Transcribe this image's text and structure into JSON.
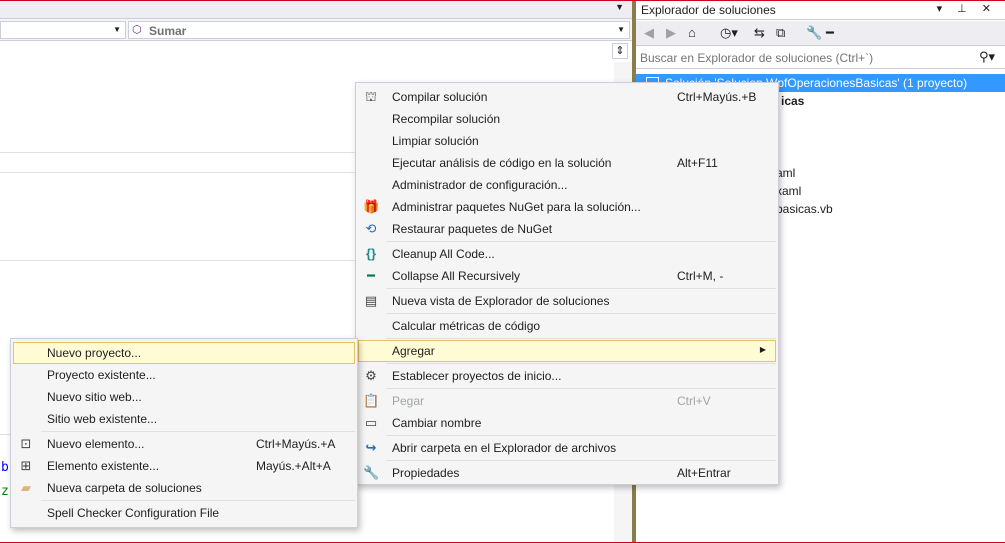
{
  "editor": {
    "nav_right_label": "Sumar",
    "code_glyphs": [
      {
        "text": "b",
        "color": "#0000ff"
      },
      {
        "text": "z",
        "color": "#008000"
      }
    ]
  },
  "solution_explorer": {
    "title": "Explorador de soluciones",
    "title_buttons": "▾ ⊥ ✕",
    "search_placeholder": "Buscar en Explorador de soluciones (Ctrl+`)",
    "tree": [
      {
        "label": "Solución 'Solucion WpfOperacionesBasicas'  (1 proyecto)",
        "selected": true
      },
      {
        "label": "icas",
        "bold": true
      },
      {
        "label": "aml"
      },
      {
        "label": "xaml"
      },
      {
        "label": "basicas.vb"
      }
    ]
  },
  "context_menu": {
    "items": [
      {
        "icon": "build-icon",
        "glyph": "⛫",
        "label": "Compilar solución",
        "shortcut": "Ctrl+Mayús.+B"
      },
      {
        "icon": "",
        "glyph": "",
        "label": "Recompilar solución",
        "shortcut": ""
      },
      {
        "icon": "",
        "glyph": "",
        "label": "Limpiar solución",
        "shortcut": ""
      },
      {
        "icon": "",
        "glyph": "",
        "label": "Ejecutar análisis de código en la solución",
        "shortcut": "Alt+F11"
      },
      {
        "icon": "",
        "glyph": "",
        "label": "Administrador de configuración...",
        "shortcut": ""
      },
      {
        "icon": "nuget-package-icon",
        "glyph": "🎁",
        "label": "Administrar paquetes NuGet para la solución...",
        "shortcut": ""
      },
      {
        "icon": "restore-package-icon",
        "glyph": "⟲",
        "label": "Restaurar paquetes de NuGet",
        "shortcut": ""
      },
      {
        "icon": "cleanup-code-icon",
        "glyph": "{}",
        "label": "Cleanup All Code...",
        "shortcut": ""
      },
      {
        "icon": "collapse-icon",
        "glyph": "━",
        "label": "Collapse All Recursively",
        "shortcut": "Ctrl+M, -"
      },
      {
        "icon": "new-explorer-view-icon",
        "glyph": "▤",
        "label": "Nueva vista de Explorador de soluciones",
        "shortcut": ""
      },
      {
        "icon": "",
        "glyph": "",
        "label": "Calcular métricas de código",
        "shortcut": ""
      },
      {
        "icon": "",
        "glyph": "",
        "label": "Agregar",
        "shortcut": "",
        "submenu": true,
        "highlight": true
      },
      {
        "icon": "gear-icon",
        "glyph": "⚙",
        "label": "Establecer proyectos de inicio...",
        "shortcut": ""
      },
      {
        "icon": "paste-icon",
        "glyph": "📋",
        "label": "Pegar",
        "shortcut": "Ctrl+V",
        "disabled": true
      },
      {
        "icon": "rename-icon",
        "glyph": "▭",
        "label": "Cambiar nombre",
        "shortcut": ""
      },
      {
        "icon": "open-folder-arrow-icon",
        "glyph": "↪",
        "label": "Abrir carpeta en el Explorador de archivos",
        "shortcut": ""
      },
      {
        "icon": "wrench-icon",
        "glyph": "🔧",
        "label": "Propiedades",
        "shortcut": "Alt+Entrar"
      }
    ],
    "submenu_arrow": "▶"
  },
  "add_submenu": {
    "items": [
      {
        "icon": "",
        "glyph": "",
        "label": "Nuevo proyecto...",
        "shortcut": "",
        "highlight": true
      },
      {
        "icon": "",
        "glyph": "",
        "label": "Proyecto existente...",
        "shortcut": ""
      },
      {
        "icon": "",
        "glyph": "",
        "label": "Nuevo sitio web...",
        "shortcut": ""
      },
      {
        "icon": "",
        "glyph": "",
        "label": "Sitio web existente...",
        "shortcut": ""
      },
      {
        "icon": "new-item-icon",
        "glyph": "⊡",
        "label": "Nuevo elemento...",
        "shortcut": "Ctrl+Mayús.+A"
      },
      {
        "icon": "existing-item-icon",
        "glyph": "⊞",
        "label": "Elemento existente...",
        "shortcut": "Mayús.+Alt+A"
      },
      {
        "icon": "new-folder-icon",
        "glyph": "▰",
        "label": "Nueva carpeta de soluciones",
        "shortcut": ""
      },
      {
        "icon": "",
        "glyph": "",
        "label": "Spell Checker Configuration File",
        "shortcut": ""
      }
    ]
  }
}
